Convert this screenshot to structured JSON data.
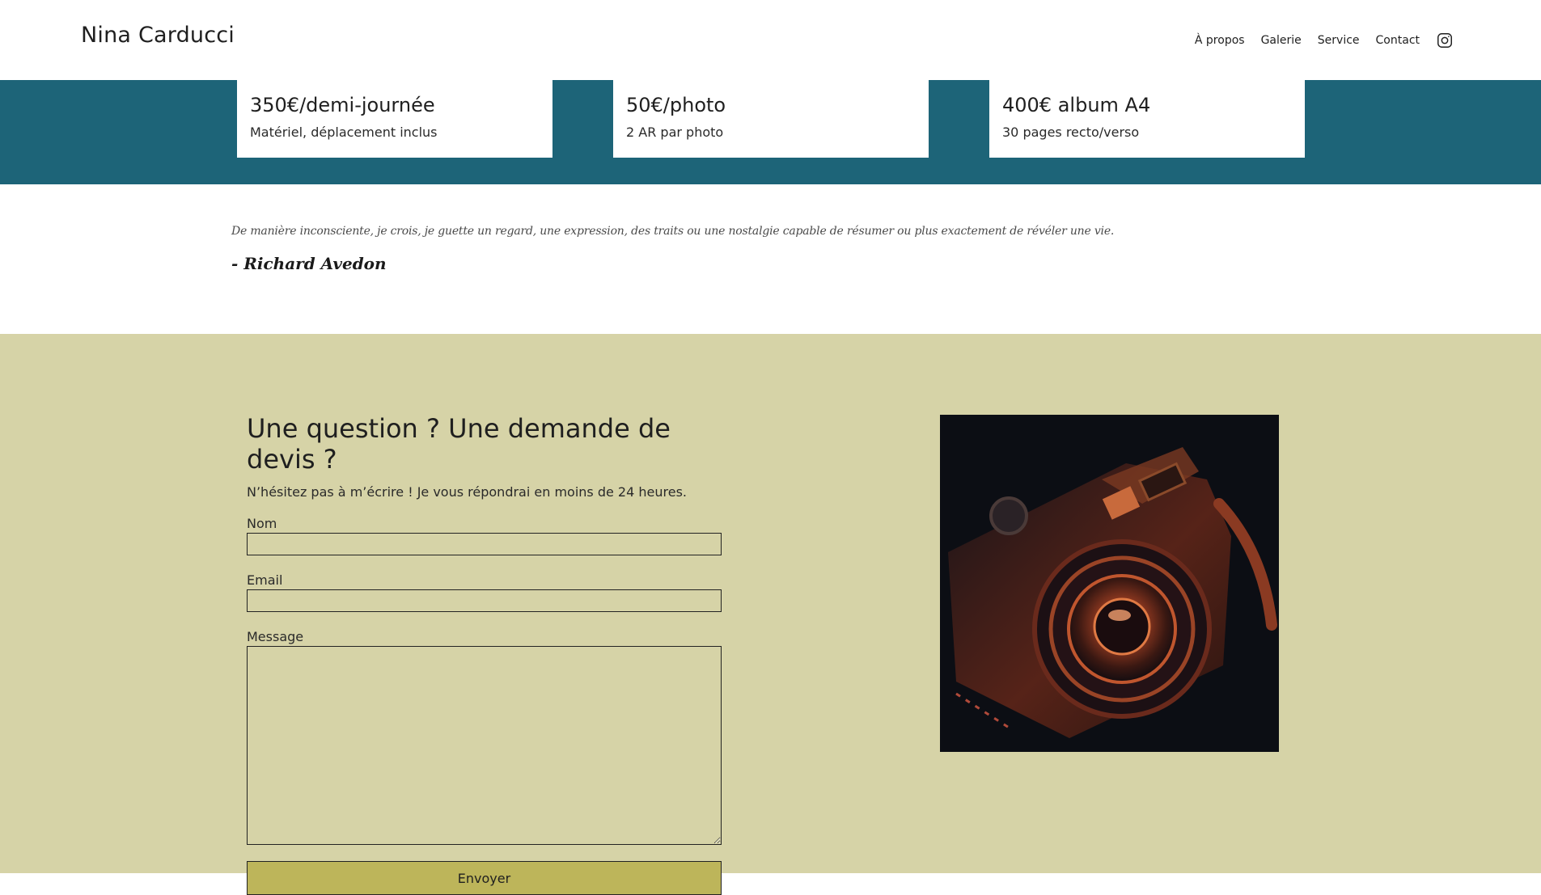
{
  "header": {
    "brand": "Nina Carducci",
    "nav": [
      "À propos",
      "Galerie",
      "Service",
      "Contact"
    ],
    "social_icon": "instagram-icon"
  },
  "pricing": [
    {
      "title": "350€/demi-journée",
      "description": "Matériel, déplacement inclus"
    },
    {
      "title": "50€/photo",
      "description": "2 AR par photo"
    },
    {
      "title": "400€ album A4",
      "description": "30 pages recto/verso"
    }
  ],
  "quote": {
    "text": "De manière inconsciente, je crois, je guette un regard, une expression, des traits ou une nostalgie capable de résumer ou plus exactement de révéler une vie.",
    "author": "- Richard Avedon"
  },
  "contact": {
    "title": "Une question ? Une demande de devis ?",
    "subtitle": "N’hésitez pas à m’écrire ! Je vous répondrai en moins de 24 heures.",
    "fields": {
      "name_label": "Nom",
      "name_value": "",
      "email_label": "Email",
      "email_value": "",
      "message_label": "Message",
      "message_value": ""
    },
    "submit_label": "Envoyer"
  },
  "colors": {
    "teal": "#1d6478",
    "sand": "#d6d3a7",
    "button": "#bdb55a"
  }
}
